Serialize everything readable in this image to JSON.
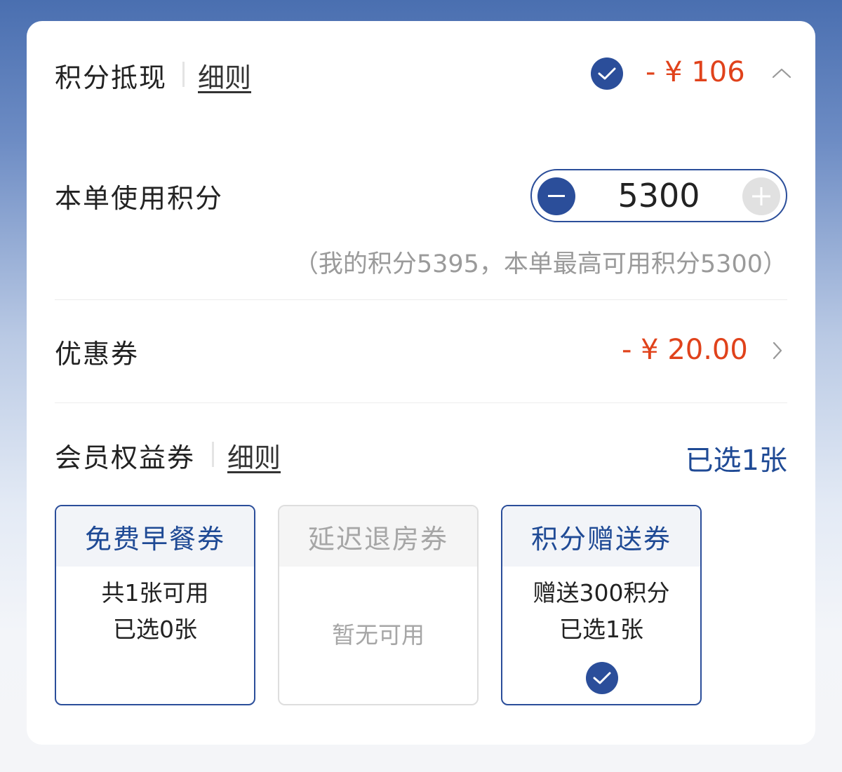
{
  "points": {
    "title": "积分抵现",
    "rules_link": "细则",
    "discount": "- ¥ 106",
    "use_label": "本单使用积分",
    "value": "5300",
    "hint": "（我的积分5395，本单最高可用积分5300）"
  },
  "coupon": {
    "title": "优惠券",
    "discount": "- ¥ 20.00"
  },
  "member": {
    "title": "会员权益券",
    "rules_link": "细则",
    "selected_summary": "已选1张",
    "vouchers": [
      {
        "name": "免费早餐券",
        "line1": "共1张可用",
        "line2": "已选0张"
      },
      {
        "name": "延迟退房券",
        "line1": "暂无可用"
      },
      {
        "name": "积分赠送券",
        "line1": "赠送300积分",
        "line2": "已选1张"
      }
    ]
  },
  "colors": {
    "brand_blue": "#2b4e9a",
    "discount_red": "#e0421b",
    "muted_gray": "#9a9a9a"
  },
  "icons": [
    "checkmark-icon",
    "chevron-up-icon",
    "minus-icon",
    "plus-icon",
    "chevron-right-icon"
  ]
}
